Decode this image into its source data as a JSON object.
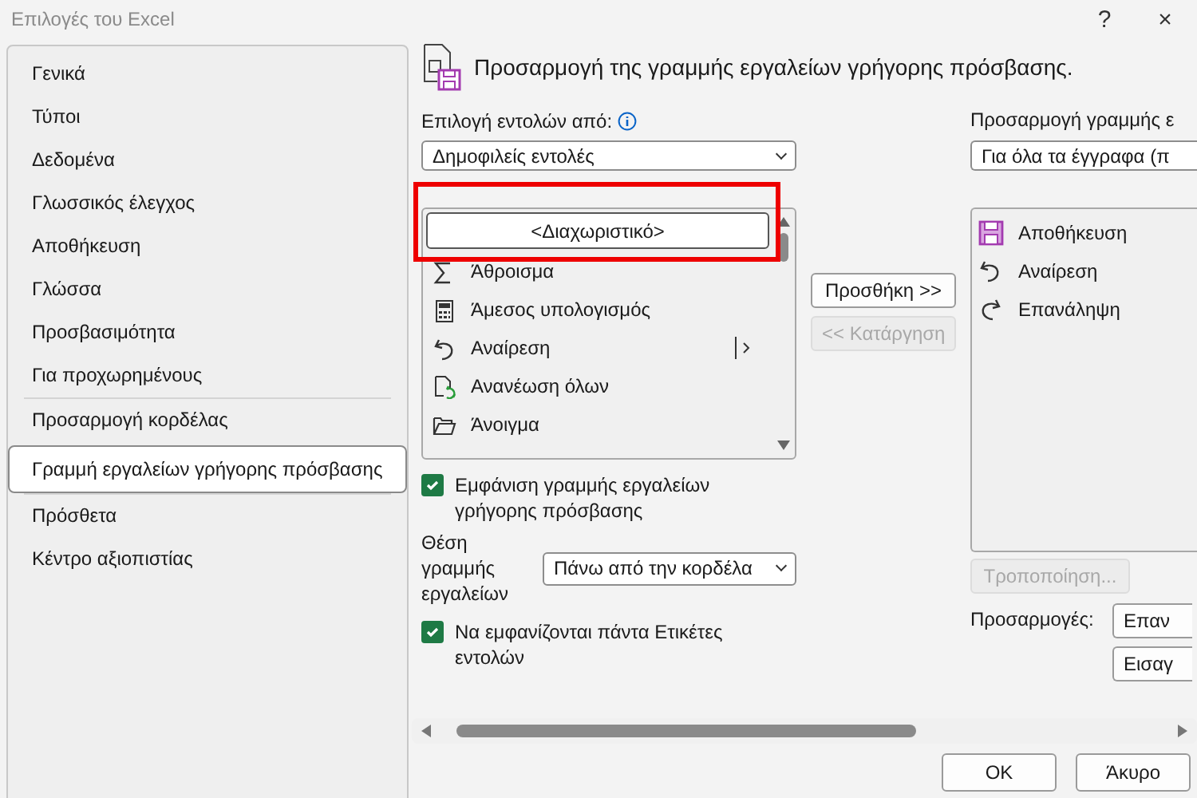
{
  "window": {
    "title": "Επιλογές του Excel",
    "help": "?",
    "close": "×"
  },
  "sidebar": {
    "items": [
      {
        "label": "Γενικά",
        "selected": false
      },
      {
        "label": "Τύποι",
        "selected": false
      },
      {
        "label": "Δεδομένα",
        "selected": false
      },
      {
        "label": "Γλωσσικός έλεγχος",
        "selected": false
      },
      {
        "label": "Αποθήκευση",
        "selected": false
      },
      {
        "label": "Γλώσσα",
        "selected": false
      },
      {
        "label": "Προσβασιμότητα",
        "selected": false
      },
      {
        "label": "Για προχωρημένους",
        "selected": false,
        "divider_after": true
      },
      {
        "label": "Προσαρμογή κορδέλας",
        "selected": false
      },
      {
        "label": "Γραμμή εργαλείων γρήγορης πρόσβασης",
        "selected": true,
        "divider_after": true
      },
      {
        "label": "Πρόσθετα",
        "selected": false
      },
      {
        "label": "Κέντρο αξιοπιστίας",
        "selected": false
      }
    ]
  },
  "header": {
    "title": "Προσαρμογή της γραμμής εργαλείων γρήγορης πρόσβασης."
  },
  "commands": {
    "label": "Επιλογή εντολών από:",
    "dropdown": "Δημοφιλείς εντολές",
    "items": [
      {
        "kind": "separator",
        "label": "<Διαχωριστικό>",
        "selected": true,
        "submenu": false
      },
      {
        "kind": "command",
        "label": "Άθροισμα",
        "selected": false,
        "submenu": false
      },
      {
        "kind": "command",
        "label": "Άμεσος υπολογισμός",
        "selected": false,
        "submenu": false
      },
      {
        "kind": "command",
        "label": "Αναίρεση",
        "selected": false,
        "submenu": true
      },
      {
        "kind": "command",
        "label": "Ανανέωση όλων",
        "selected": false,
        "submenu": false
      },
      {
        "kind": "command",
        "label": "Άνοιγμα",
        "selected": false,
        "submenu": false
      }
    ]
  },
  "show_toolbar": {
    "label": "Εμφάνιση γραμμής εργαλείων γρήγορης πρόσβασης",
    "checked": true
  },
  "position": {
    "label": "Θέση γραμμής εργαλείων",
    "dropdown": "Πάνω από την κορδέλα"
  },
  "always_labels": {
    "label": "Να εμφανίζονται πάντα Ετικέτες εντολών",
    "checked": true
  },
  "middle_buttons": [
    {
      "label": "Προσθήκη >>",
      "disabled": false
    },
    {
      "label": "<< Κατάργηση",
      "disabled": true
    }
  ],
  "toolbar": {
    "label": "Προσαρμογή γραμμής ε",
    "dropdown": "Για όλα τα έγγραφα (π",
    "items": [
      {
        "label": "Αποθήκευση"
      },
      {
        "label": "Αναίρεση"
      },
      {
        "label": "Επανάληψη"
      }
    ],
    "modify_button": {
      "label": "Τροποποίηση...",
      "disabled": true
    },
    "customizations_label": "Προσαρμογές:",
    "customizations_buttons": [
      "Επαν",
      "Εισαγ"
    ]
  },
  "footer_buttons": [
    "OK",
    "Άκυρο"
  ]
}
